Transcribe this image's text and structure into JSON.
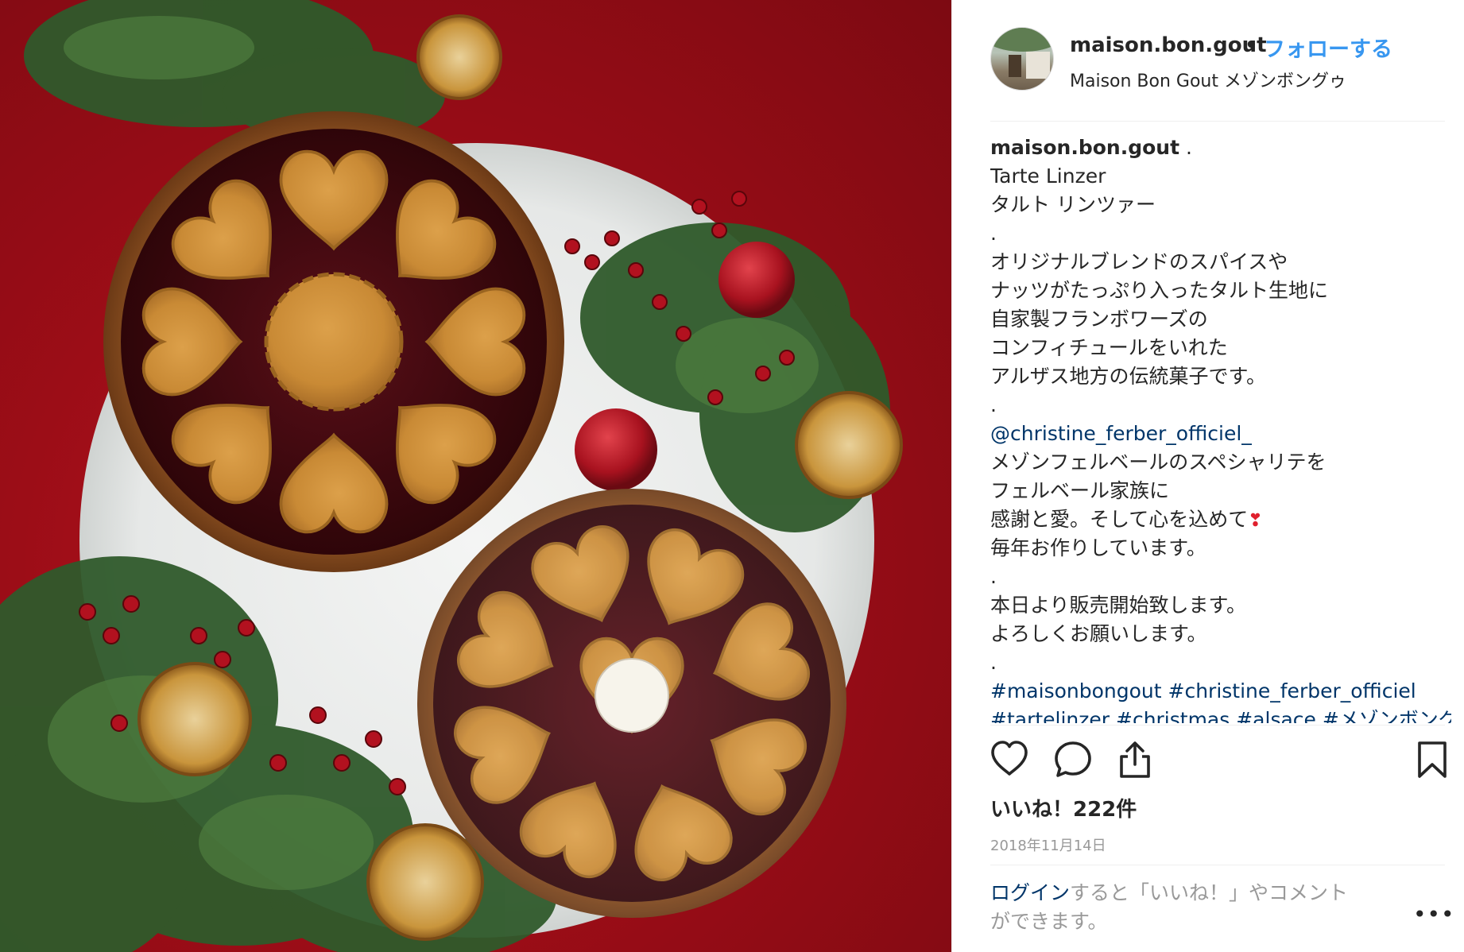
{
  "photo": {
    "alt_icon": "photo-image"
  },
  "header": {
    "username": "maison.bon.gout",
    "separator": "•",
    "follow_label": "フォローする",
    "location": "Maison Bon Gout メゾンボングゥ"
  },
  "caption": {
    "username": "maison.bon.gout",
    "after_username": " .",
    "lines": [
      "Tarte Linzer",
      "タルト リンツァー",
      ".",
      "オリジナルブレンドのスパイスや",
      "ナッツがたっぷり入ったタルト生地に",
      "自家製フランボワーズの",
      "コンフィチュールをいれた",
      "アルザス地方の伝統菓子です。",
      "."
    ],
    "mention": "@christine_ferber_officiel_",
    "lines2": [
      "メゾンフェルベールのスペシャリテを",
      "フェルベール家族に"
    ],
    "line_emoji": "感謝と愛。そして心を込めて",
    "emoji": "❣",
    "lines3": [
      "毎年お作りしています。",
      ".",
      "本日より販売開始致します。",
      "よろしくお願いします。",
      "."
    ],
    "hashtags": "#maisonbongout #christine_ferber_officiel",
    "hashtags_cut": "#tartelinzer #christmas #alsace #メゾンボングゥ"
  },
  "actions": {
    "like_icon": "heart-outline-icon",
    "comment_icon": "comment-bubble-icon",
    "share_icon": "share-upload-icon",
    "save_icon": "bookmark-icon"
  },
  "likes": "いいね！222件",
  "date": "2018年11月14日",
  "login": {
    "link": "ログイン",
    "rest": "すると「いいね！」やコメント",
    "rest2": "ができます。"
  },
  "more_label": "•••",
  "colors": {
    "accent": "#3897f0",
    "link": "#003569",
    "muted": "#999999",
    "text": "#262626"
  }
}
